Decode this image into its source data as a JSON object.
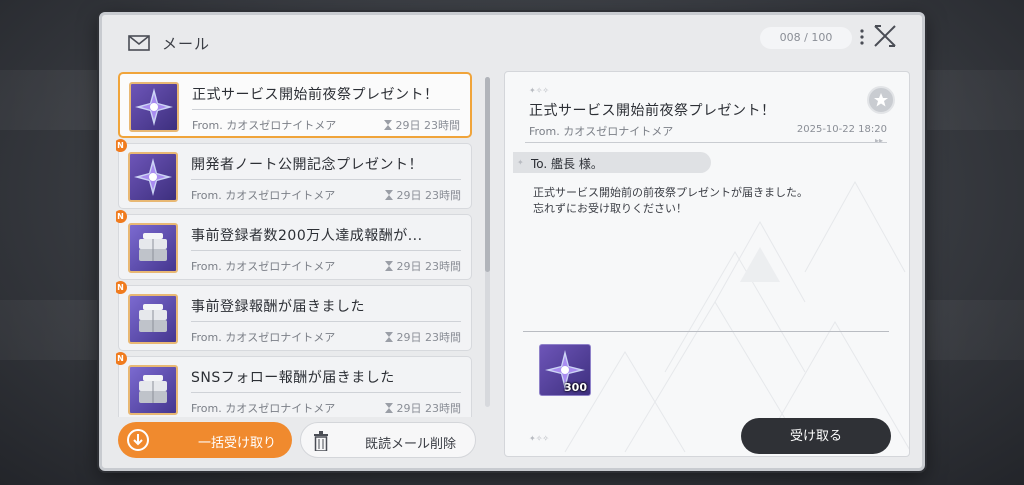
{
  "header": {
    "title": "メール",
    "counter": "008 / 100"
  },
  "mails": [
    {
      "title": "正式サービス開始前夜祭プレゼント！",
      "from": "From. カオスゼロナイトメア",
      "time": "29日 23時間",
      "is_new": false,
      "selected": true,
      "item": "crystal"
    },
    {
      "title": "開発者ノート公開記念プレゼント！",
      "from": "From. カオスゼロナイトメア",
      "time": "29日 23時間",
      "is_new": true,
      "badge": "N",
      "selected": false,
      "item": "crystal"
    },
    {
      "title": "事前登録者数200万人達成報酬が...",
      "from": "From. カオスゼロナイトメア",
      "time": "29日 23時間",
      "is_new": true,
      "badge": "N",
      "selected": false,
      "item": "silver-box"
    },
    {
      "title": "事前登録報酬が届きました",
      "from": "From. カオスゼロナイトメア",
      "time": "29日 23時間",
      "is_new": true,
      "badge": "N",
      "selected": false,
      "item": "silver-box"
    },
    {
      "title": "SNSフォロー報酬が届きました",
      "from": "From. カオスゼロナイトメア",
      "time": "29日 23時間",
      "is_new": true,
      "badge": "N",
      "selected": false,
      "item": "silver-box"
    }
  ],
  "actions": {
    "receive_all": "一括受け取り",
    "delete_read": "既読メール削除"
  },
  "detail": {
    "title": "正式サービス開始前夜祭プレゼント！",
    "from": "From. カオスゼロナイトメア",
    "date": "2025-10-22 18:20",
    "to": "To. 艦長 様。",
    "body": [
      "正式サービス開始前の前夜祭プレゼントが届きました。",
      "忘れずにお受け取りください！"
    ],
    "attachment": {
      "item": "crystal",
      "quantity": "300"
    },
    "receive_label": "受け取る"
  },
  "colors": {
    "accent": "#f08a2e",
    "new_badge": "#f07b1e",
    "dark_button": "#2f3136",
    "item_bg": "#5a45a3"
  },
  "icons": [
    "mail-icon",
    "more-icon",
    "close-icon",
    "hourglass-icon",
    "download-icon",
    "trash-icon",
    "star-icon"
  ]
}
